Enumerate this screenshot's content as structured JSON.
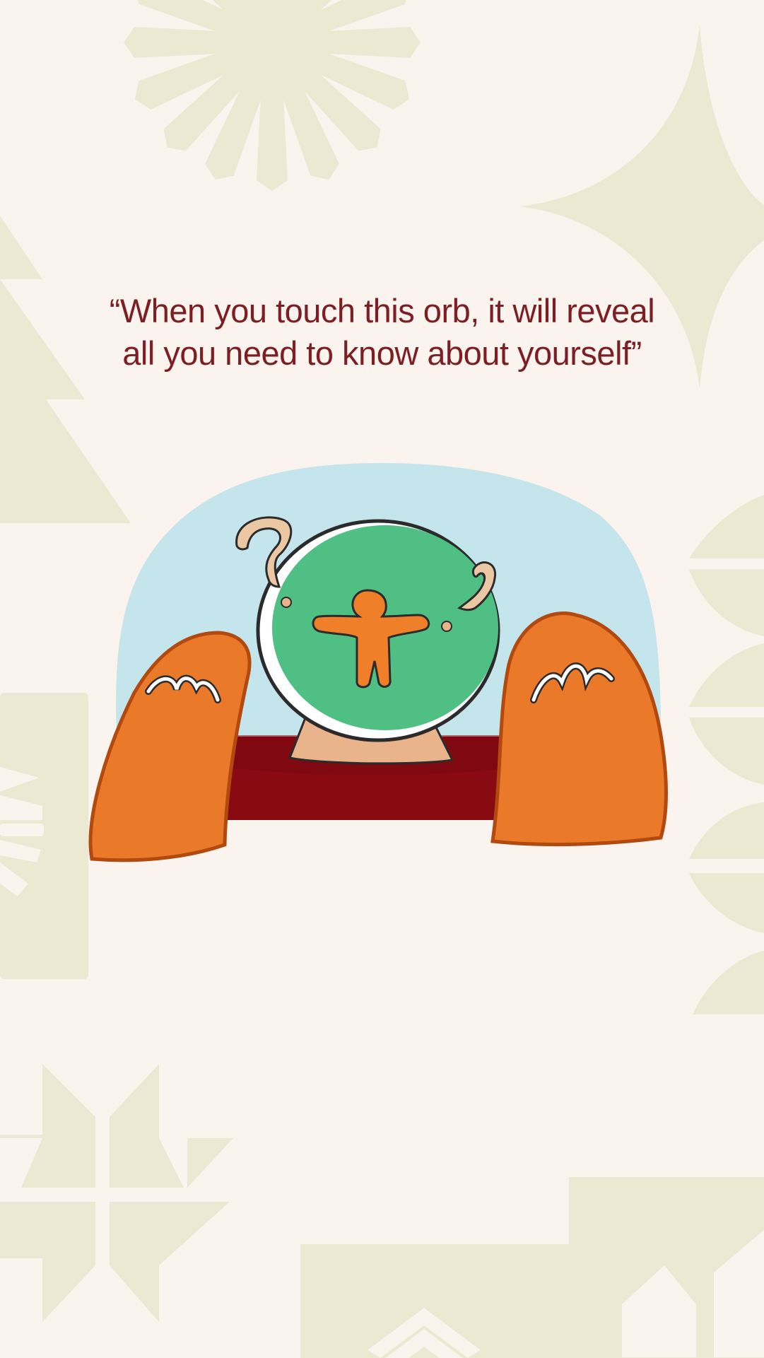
{
  "quote": {
    "line1": "“When you touch this orb, it will reveal",
    "line2": "all you need to know about yourself”"
  },
  "illustration": {
    "subject": "two orange hands reaching toward a green crystal orb with an orange figure inside, set on a tan stand over a dark red table",
    "icon_names": [
      "crystal-orb-icon",
      "person-figure-icon",
      "question-mark-icon",
      "hand-left-icon",
      "hand-right-icon"
    ]
  },
  "colors": {
    "background": "#fbf3ee",
    "decor_shapes": "#ebe9d2",
    "quote_text": "#7d1e22",
    "sky": "#c5e5ec",
    "orb": "#4fbf84",
    "figure": "#f07f2a",
    "hands": "#ea7a2a",
    "hand_outline": "#b24a10",
    "stand": "#e9b48b",
    "table": "#8a0a12",
    "swirl": "#ecc7a4"
  }
}
